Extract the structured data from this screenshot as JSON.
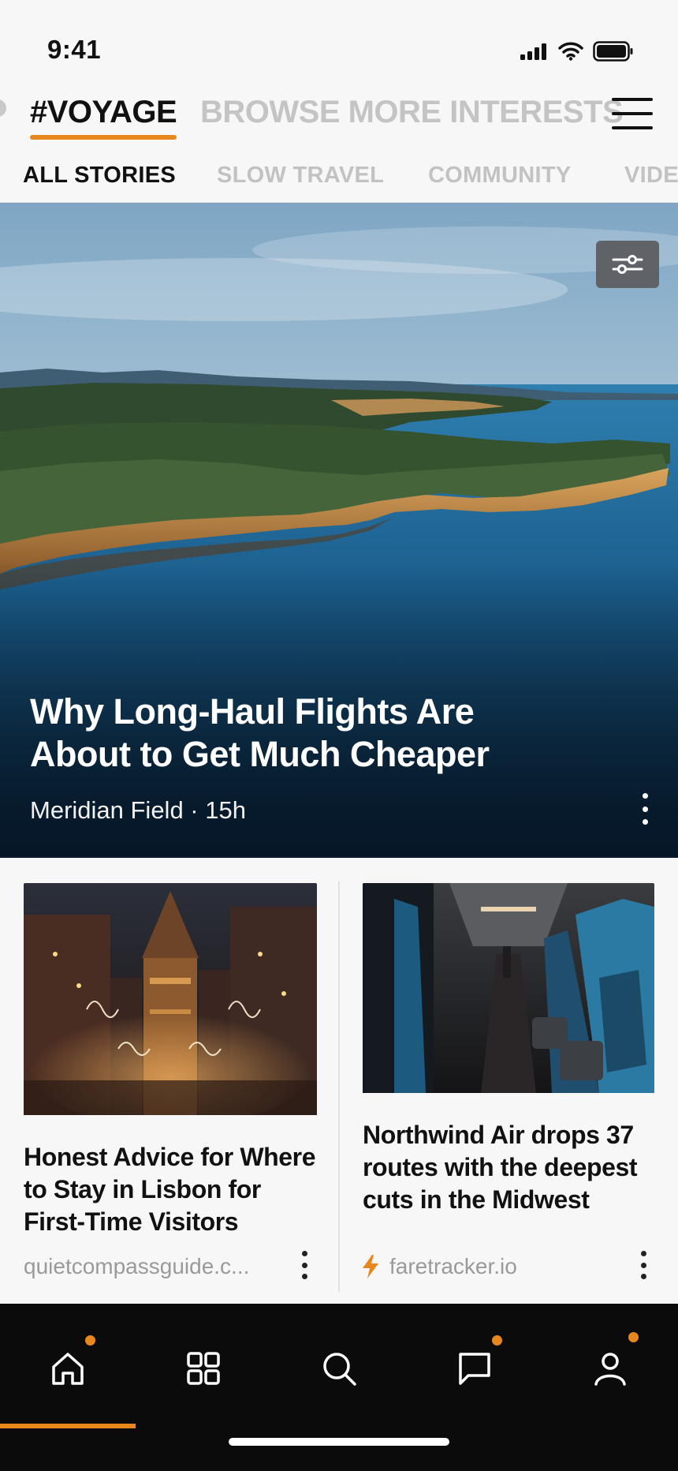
{
  "status_bar": {
    "time": "9:41"
  },
  "interest_bar": {
    "active_label": "#VOYAGE",
    "more_label": "BROWSE MORE INTERESTS"
  },
  "tabs": [
    {
      "label": "ALL STORIES",
      "active": true
    },
    {
      "label": "SLOW TRAVEL",
      "active": false
    },
    {
      "label": "COMMUNITY",
      "active": false
    },
    {
      "label": "VIDE",
      "active": false
    }
  ],
  "hero": {
    "title": "Why Long-Haul Flights Are About to Get Much Cheaper",
    "meta": "Meridian Field · 15h"
  },
  "cards": [
    {
      "headline": "Honest Advice for Where to Stay in Lisbon for First-Time Visitors",
      "source": "quietcompassguide.c..."
    },
    {
      "headline": "Northwind Air drops 37 routes with the deepest cuts in the Midwest",
      "source": "faretracker.io",
      "source_icon": "lightning-icon"
    }
  ],
  "bottom_nav": {
    "items": [
      {
        "icon": "home-icon",
        "badge": true,
        "active": true
      },
      {
        "icon": "grid-icon",
        "badge": false,
        "active": false
      },
      {
        "icon": "search-icon",
        "badge": false,
        "active": false
      },
      {
        "icon": "chat-icon",
        "badge": true,
        "active": false
      },
      {
        "icon": "profile-icon",
        "badge": true,
        "active": false
      }
    ]
  },
  "colors": {
    "accent": "#e8871e",
    "nav_background": "#0b0b0b",
    "inactive_text": "#c2c2c2"
  }
}
